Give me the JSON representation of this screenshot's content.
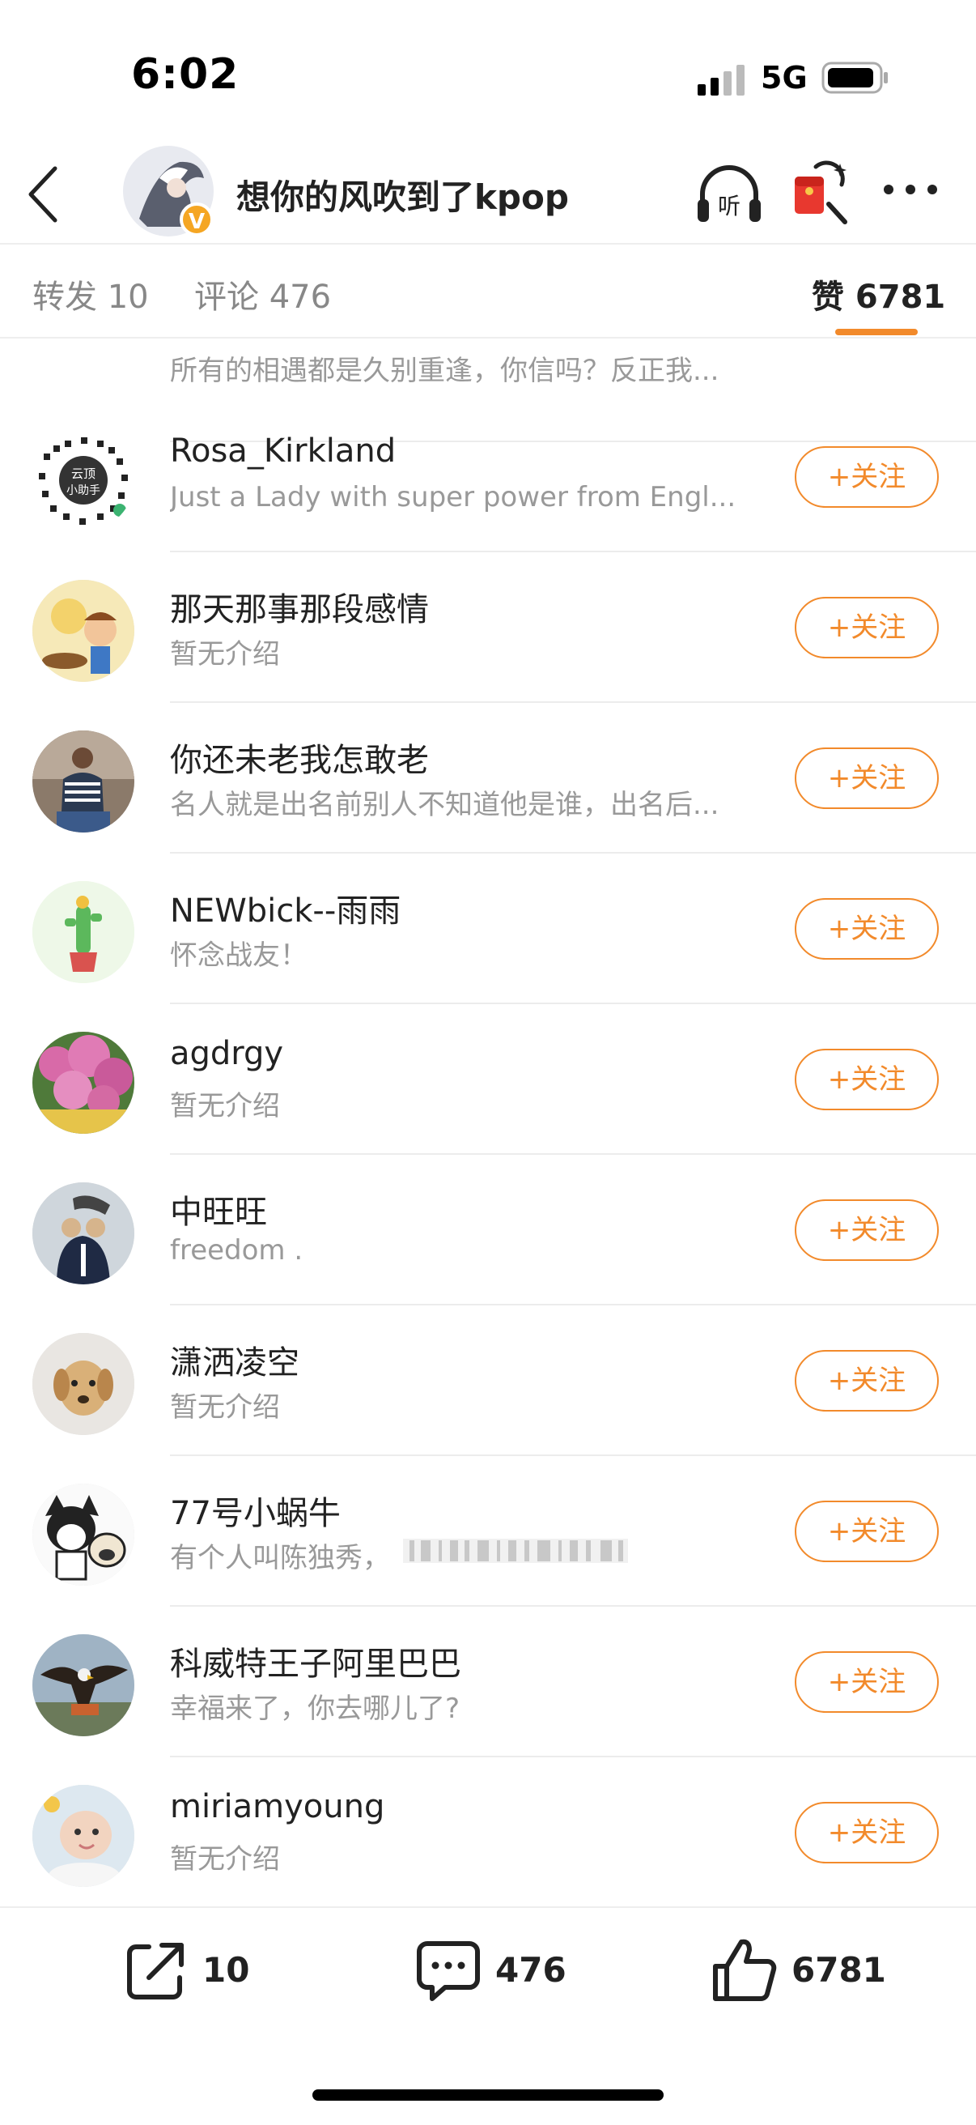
{
  "status_bar": {
    "time": "6:02",
    "network": "5G"
  },
  "header": {
    "title": "想你的风吹到了kpop",
    "verified_mark": "V"
  },
  "tabs": [
    {
      "label": "转发 10"
    },
    {
      "label": "评论 476"
    },
    {
      "label": "赞 6781"
    }
  ],
  "partial_row": {
    "bio": "所有的相遇都是久别重逢，你信吗？反正我..."
  },
  "follow_label": "+关注",
  "rows": [
    {
      "name": "Rosa_Kirkland",
      "bio": "Just a Lady with super power from Engl..."
    },
    {
      "name": "那天那事那段感情",
      "bio": "暂无介绍"
    },
    {
      "name": "你还未老我怎敢老",
      "bio": "名人就是出名前别人不知道他是谁，出名后..."
    },
    {
      "name": "NEWbick--雨雨",
      "bio": "怀念战友！"
    },
    {
      "name": "agdrgy",
      "bio": "暂无介绍"
    },
    {
      "name": "中旺旺",
      "bio": "freedom ."
    },
    {
      "name": "潇洒凌空",
      "bio": "暂无介绍"
    },
    {
      "name": "77号小蜗牛",
      "bio": "有个人叫陈独秀，"
    },
    {
      "name": "科威特王子阿里巴巴",
      "bio": "幸福来了，你去哪儿了?"
    },
    {
      "name": "miriamyoung",
      "bio": "暂无介绍"
    }
  ],
  "bottom_bar": {
    "repost_count": "10",
    "comment_count": "476",
    "like_count": "6781"
  },
  "qr_text": [
    "云顶",
    "小助手"
  ],
  "colors": {
    "accent": "#f28a2b",
    "verified": "#f5a623"
  }
}
